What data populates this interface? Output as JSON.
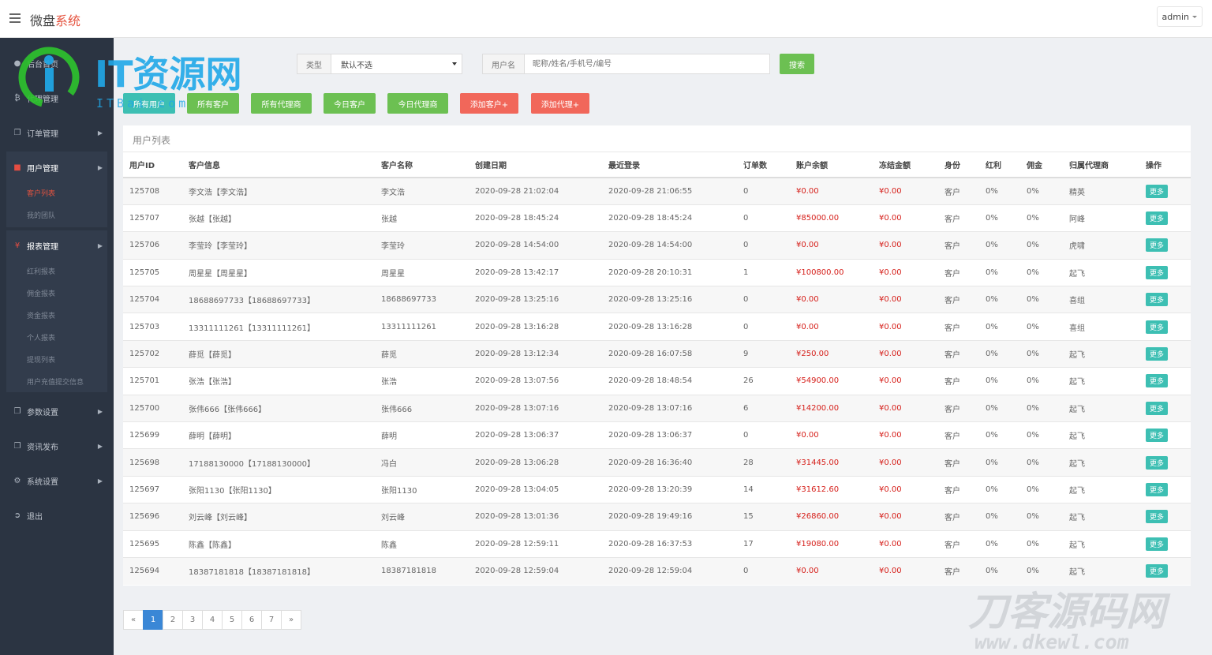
{
  "app": {
    "brand_prefix": "微盘",
    "brand_accent": "系统",
    "user": "admin"
  },
  "sidebar": {
    "items": [
      {
        "label": "后台首页",
        "icon": "dashboard-icon"
      },
      {
        "label": "代理管理",
        "icon": "bitcoin-icon"
      },
      {
        "label": "订单管理",
        "icon": "copy-icon"
      },
      {
        "label": "用户管理",
        "icon": "user-icon"
      },
      {
        "label": "报表管理",
        "icon": "yen-icon"
      },
      {
        "label": "参数设置",
        "icon": "copy-icon"
      },
      {
        "label": "资讯发布",
        "icon": "copy-icon"
      },
      {
        "label": "系统设置",
        "icon": "cogs-icon"
      },
      {
        "label": "退出",
        "icon": "sign-out-icon"
      }
    ],
    "user_sub": [
      "客户列表",
      "我的团队"
    ],
    "report_sub": [
      "红利报表",
      "佣金报表",
      "资金报表",
      "个人报表",
      "提现列表",
      "用户充值提交信息"
    ]
  },
  "filter": {
    "type_label": "类型",
    "type_value": "默认不选",
    "user_label": "用户名",
    "search_placeholder": "昵称/姓名/手机号/编号",
    "search_button": "搜索"
  },
  "buttons": {
    "all_users": "所有用户",
    "all_clients": "所有客户",
    "all_agents": "所有代理商",
    "today_clients": "今日客户",
    "today_agents": "今日代理商",
    "add_client": "添加客户+",
    "add_agent": "添加代理+"
  },
  "panel": {
    "title": "用户列表"
  },
  "table": {
    "columns": [
      "用户ID",
      "客户信息",
      "客户名称",
      "创建日期",
      "最近登录",
      "订单数",
      "账户余额",
      "冻结金额",
      "身份",
      "红利",
      "佣金",
      "归属代理商",
      "操作"
    ],
    "action_label": "更多",
    "rows": [
      [
        "125708",
        "李文浩【李文浩】",
        "李文浩",
        "2020-09-28 21:02:04",
        "2020-09-28 21:06:55",
        "0",
        "¥0.00",
        "¥0.00",
        "客户",
        "0%",
        "0%",
        "精英"
      ],
      [
        "125707",
        "张越【张越】",
        "张越",
        "2020-09-28 18:45:24",
        "2020-09-28 18:45:24",
        "0",
        "¥85000.00",
        "¥0.00",
        "客户",
        "0%",
        "0%",
        "阿峰"
      ],
      [
        "125706",
        "李莹玲【李莹玲】",
        "李莹玲",
        "2020-09-28 14:54:00",
        "2020-09-28 14:54:00",
        "0",
        "¥0.00",
        "¥0.00",
        "客户",
        "0%",
        "0%",
        "虎啸"
      ],
      [
        "125705",
        "周星星【周星星】",
        "周星星",
        "2020-09-28 13:42:17",
        "2020-09-28 20:10:31",
        "1",
        "¥100800.00",
        "¥0.00",
        "客户",
        "0%",
        "0%",
        "起飞"
      ],
      [
        "125704",
        "18688697733【18688697733】",
        "18688697733",
        "2020-09-28 13:25:16",
        "2020-09-28 13:25:16",
        "0",
        "¥0.00",
        "¥0.00",
        "客户",
        "0%",
        "0%",
        "喜组"
      ],
      [
        "125703",
        "13311111261【13311111261】",
        "13311111261",
        "2020-09-28 13:16:28",
        "2020-09-28 13:16:28",
        "0",
        "¥0.00",
        "¥0.00",
        "客户",
        "0%",
        "0%",
        "喜组"
      ],
      [
        "125702",
        "薛觅【薛觅】",
        "薛觅",
        "2020-09-28 13:12:34",
        "2020-09-28 16:07:58",
        "9",
        "¥250.00",
        "¥0.00",
        "客户",
        "0%",
        "0%",
        "起飞"
      ],
      [
        "125701",
        "张浩【张浩】",
        "张浩",
        "2020-09-28 13:07:56",
        "2020-09-28 18:48:54",
        "26",
        "¥54900.00",
        "¥0.00",
        "客户",
        "0%",
        "0%",
        "起飞"
      ],
      [
        "125700",
        "张伟666【张伟666】",
        "张伟666",
        "2020-09-28 13:07:16",
        "2020-09-28 13:07:16",
        "6",
        "¥14200.00",
        "¥0.00",
        "客户",
        "0%",
        "0%",
        "起飞"
      ],
      [
        "125699",
        "薛明【薛明】",
        "薛明",
        "2020-09-28 13:06:37",
        "2020-09-28 13:06:37",
        "0",
        "¥0.00",
        "¥0.00",
        "客户",
        "0%",
        "0%",
        "起飞"
      ],
      [
        "125698",
        "17188130000【17188130000】",
        "冯白",
        "2020-09-28 13:06:28",
        "2020-09-28 16:36:40",
        "28",
        "¥31445.00",
        "¥0.00",
        "客户",
        "0%",
        "0%",
        "起飞"
      ],
      [
        "125697",
        "张阳1130【张阳1130】",
        "张阳1130",
        "2020-09-28 13:04:05",
        "2020-09-28 13:20:39",
        "14",
        "¥31612.60",
        "¥0.00",
        "客户",
        "0%",
        "0%",
        "起飞"
      ],
      [
        "125696",
        "刘云峰【刘云峰】",
        "刘云峰",
        "2020-09-28 13:01:36",
        "2020-09-28 19:49:16",
        "15",
        "¥26860.00",
        "¥0.00",
        "客户",
        "0%",
        "0%",
        "起飞"
      ],
      [
        "125695",
        "陈鑫【陈鑫】",
        "陈鑫",
        "2020-09-28 12:59:11",
        "2020-09-28 16:37:53",
        "17",
        "¥19080.00",
        "¥0.00",
        "客户",
        "0%",
        "0%",
        "起飞"
      ],
      [
        "125694",
        "18387181818【18387181818】",
        "18387181818",
        "2020-09-28 12:59:04",
        "2020-09-28 12:59:04",
        "0",
        "¥0.00",
        "¥0.00",
        "客户",
        "0%",
        "0%",
        "起飞"
      ]
    ]
  },
  "pagination": {
    "prev": "«",
    "pages": [
      "1",
      "2",
      "3",
      "4",
      "5",
      "6",
      "7"
    ],
    "next": "»",
    "current": "1"
  },
  "watermarks": {
    "logo_text": "IT资源网",
    "logo_sub": "ITBai.com",
    "right_text": "刀客源码网",
    "right_sub": "www.dkewl.com"
  },
  "colors": {
    "sidebar": "#2b3442",
    "accent_red": "#e5533f",
    "green": "#6cc052",
    "teal": "#3dbfb3",
    "red_button": "#f1675a",
    "page_active": "#3a87d6",
    "money": "#d6201b"
  }
}
